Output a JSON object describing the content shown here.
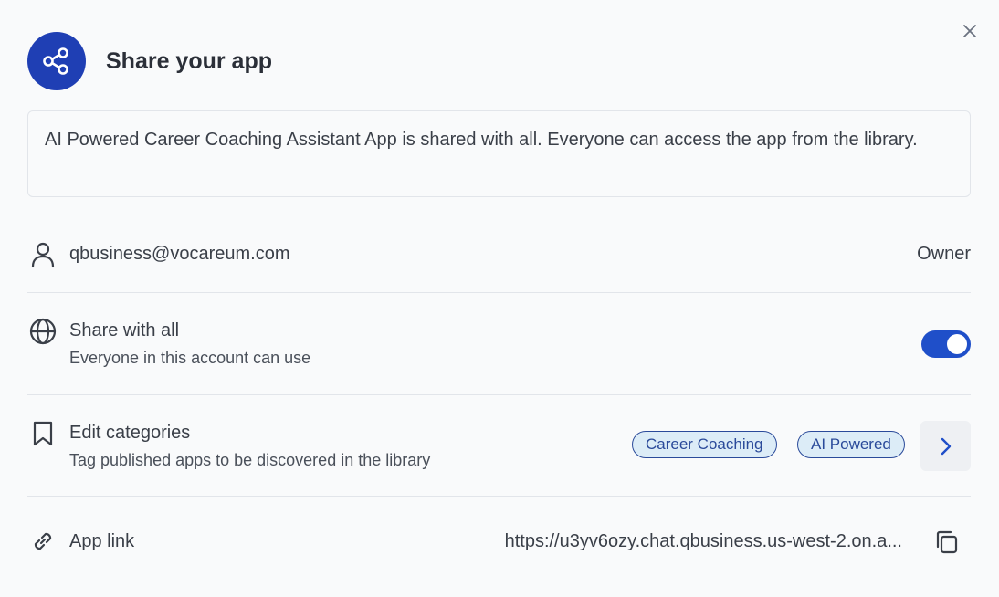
{
  "dialog": {
    "title": "Share your app",
    "info": "AI Powered Career Coaching Assistant App is shared with all. Everyone can access the app from the library."
  },
  "owner_row": {
    "email": "qbusiness@vocareum.com",
    "role": "Owner"
  },
  "share_row": {
    "label": "Share with all",
    "description": "Everyone in this account can use",
    "enabled": true
  },
  "categories_row": {
    "label": "Edit categories",
    "description": "Tag published apps to be discovered in the library",
    "tags": [
      "Career Coaching",
      "AI Powered"
    ]
  },
  "link_row": {
    "label": "App link",
    "url": "https://u3yv6ozy.chat.qbusiness.us-west-2.on.a..."
  },
  "colors": {
    "accent": "#1f4fc9",
    "header_icon_bg": "#1f3fb4",
    "chip_bg": "#dcecf7",
    "chip_border": "#2a4a9a"
  },
  "icons": {
    "header": "share-icon",
    "close": "close-icon",
    "owner": "user-icon",
    "share": "globe-icon",
    "categories": "bookmark-icon",
    "chevron": "chevron-right-icon",
    "link": "link-icon",
    "copy": "copy-icon"
  }
}
